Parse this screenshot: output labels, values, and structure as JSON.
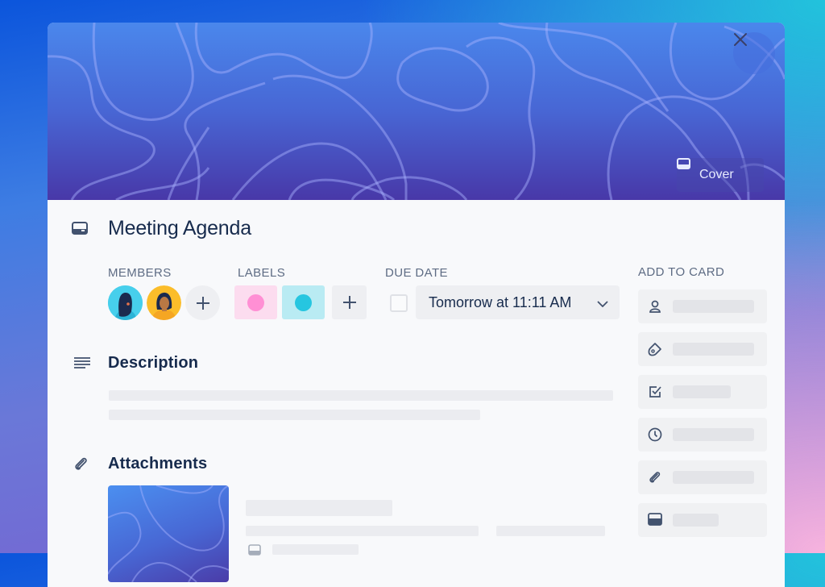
{
  "card": {
    "title": "Meeting Agenda",
    "cover_button_label": "Cover",
    "close_icon": "close-icon",
    "cover_icon": "card-cover-icon",
    "title_icon": "card-icon"
  },
  "members": {
    "label": "MEMBERS",
    "avatars": [
      {
        "name": "member-avatar-1",
        "bg": "#3cc8e6"
      },
      {
        "name": "member-avatar-2",
        "bg": "#fbbd2a"
      }
    ],
    "add_label": "+"
  },
  "labels": {
    "label": "LABELS",
    "items": [
      {
        "chip_bg": "#fcdcef",
        "dot": "#ff8fd4"
      },
      {
        "chip_bg": "#b9ebf3",
        "dot": "#26c6e0"
      }
    ],
    "add_label": "+"
  },
  "due_date": {
    "label": "DUE DATE",
    "value": "Tomorrow at 11:11 AM",
    "completed": false
  },
  "description": {
    "heading": "Description",
    "icon": "description-icon"
  },
  "attachments": {
    "heading": "Attachments",
    "icon": "attachment-icon"
  },
  "sidebar": {
    "heading": "ADD TO CARD",
    "items": [
      {
        "icon": "member-icon"
      },
      {
        "icon": "label-icon"
      },
      {
        "icon": "checklist-icon"
      },
      {
        "icon": "clock-icon"
      },
      {
        "icon": "attachment-icon"
      },
      {
        "icon": "cover-icon"
      }
    ]
  },
  "colors": {
    "text_primary": "#172b4d",
    "text_secondary": "#5e6c84",
    "placeholder": "#ebecf0"
  }
}
